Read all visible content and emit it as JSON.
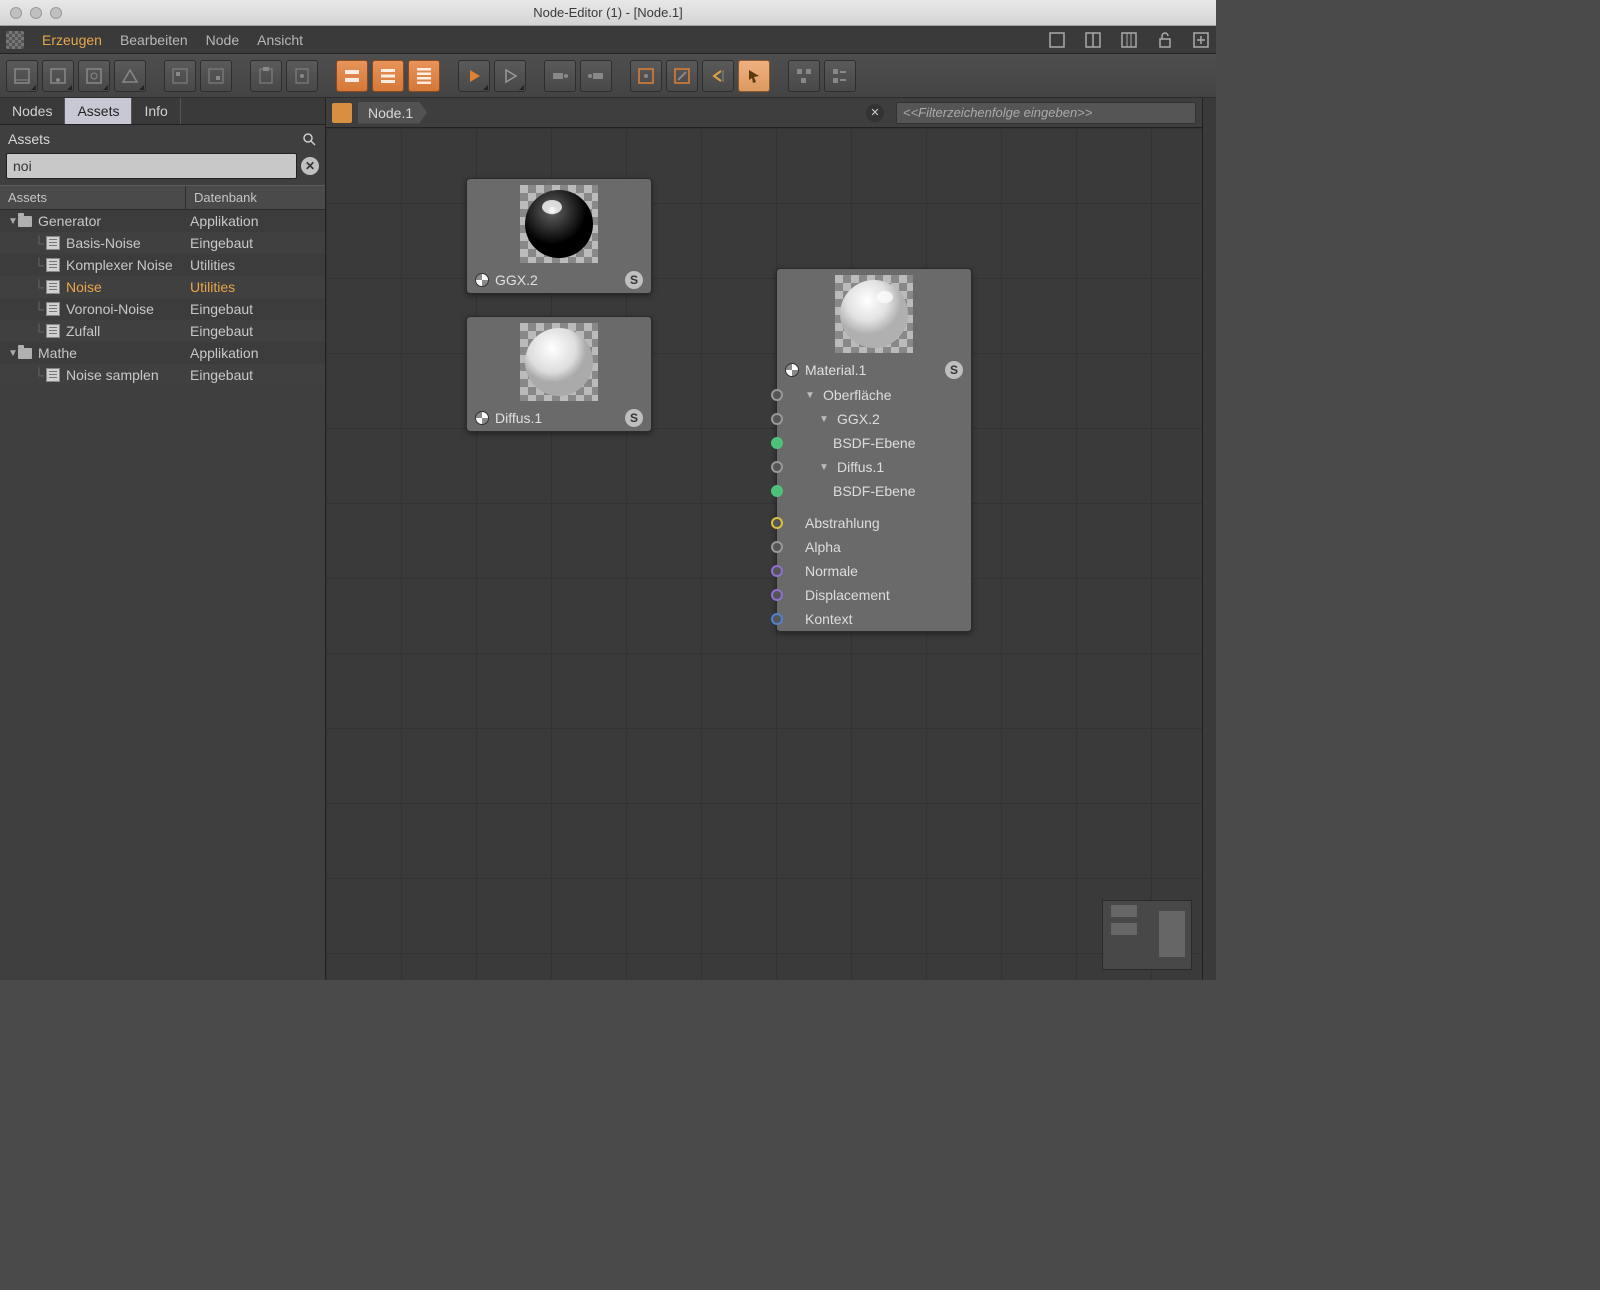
{
  "window": {
    "title": "Node-Editor (1) - [Node.1]"
  },
  "menu": {
    "items": [
      "Erzeugen",
      "Bearbeiten",
      "Node",
      "Ansicht"
    ],
    "active_index": 0
  },
  "left_panel": {
    "tabs": [
      "Nodes",
      "Assets",
      "Info"
    ],
    "active_tab_index": 1,
    "heading": "Assets",
    "search_value": "noi",
    "columns": {
      "c1": "Assets",
      "c2": "Datenbank"
    },
    "tree": [
      {
        "type": "folder",
        "depth": 0,
        "label": "Generator",
        "db": "Applikation",
        "expanded": true
      },
      {
        "type": "item",
        "depth": 1,
        "label": "Basis-Noise",
        "db": "Eingebaut"
      },
      {
        "type": "item",
        "depth": 1,
        "label": "Komplexer Noise",
        "db": "Utilities"
      },
      {
        "type": "item",
        "depth": 1,
        "label": "Noise",
        "db": "Utilities",
        "highlight": true
      },
      {
        "type": "item",
        "depth": 1,
        "label": "Voronoi-Noise",
        "db": "Eingebaut"
      },
      {
        "type": "item",
        "depth": 1,
        "label": "Zufall",
        "db": "Eingebaut"
      },
      {
        "type": "folder",
        "depth": 0,
        "label": "Mathe",
        "db": "Applikation",
        "expanded": true
      },
      {
        "type": "item",
        "depth": 1,
        "label": "Noise samplen",
        "db": "Eingebaut"
      }
    ]
  },
  "canvas": {
    "breadcrumb": "Node.1",
    "filter_placeholder": "<<Filterzeichenfolge eingeben>>",
    "nodes": {
      "ggx": {
        "title": "GGX.2",
        "badge": "S"
      },
      "diffus": {
        "title": "Diffus.1",
        "badge": "S"
      },
      "material": {
        "title": "Material.1",
        "badge": "S",
        "ports": [
          {
            "label": "Oberfläche",
            "dot": "plain",
            "twist": true,
            "indent": 0
          },
          {
            "label": "GGX.2",
            "dot": "plain",
            "twist": true,
            "indent": 1
          },
          {
            "label": "BSDF-Ebene",
            "dot": "green",
            "twist": false,
            "indent": 2
          },
          {
            "label": "Diffus.1",
            "dot": "plain",
            "twist": true,
            "indent": 1
          },
          {
            "label": "BSDF-Ebene",
            "dot": "green",
            "twist": false,
            "indent": 2
          },
          {
            "label": "Abstrahlung",
            "dot": "yellow",
            "twist": false,
            "indent": 0,
            "gap": true
          },
          {
            "label": "Alpha",
            "dot": "plain",
            "twist": false,
            "indent": 0
          },
          {
            "label": "Normale",
            "dot": "purple",
            "twist": false,
            "indent": 0
          },
          {
            "label": "Displacement",
            "dot": "purple",
            "twist": false,
            "indent": 0
          },
          {
            "label": "Kontext",
            "dot": "blue",
            "twist": false,
            "indent": 0
          }
        ]
      }
    }
  }
}
